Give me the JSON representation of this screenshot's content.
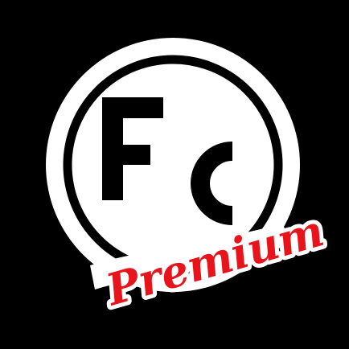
{
  "logo": {
    "monogram_f": "F",
    "monogram_c": "C",
    "wordmark": "Premium",
    "icon_name": "fc-premium-logo-icon"
  },
  "colors": {
    "background": "#000000",
    "badge_fill": "#ffffff",
    "ring_stroke": "#000000",
    "monogram": "#000000",
    "wordmark": "#e8141c",
    "wordmark_outline": "#ffffff"
  }
}
